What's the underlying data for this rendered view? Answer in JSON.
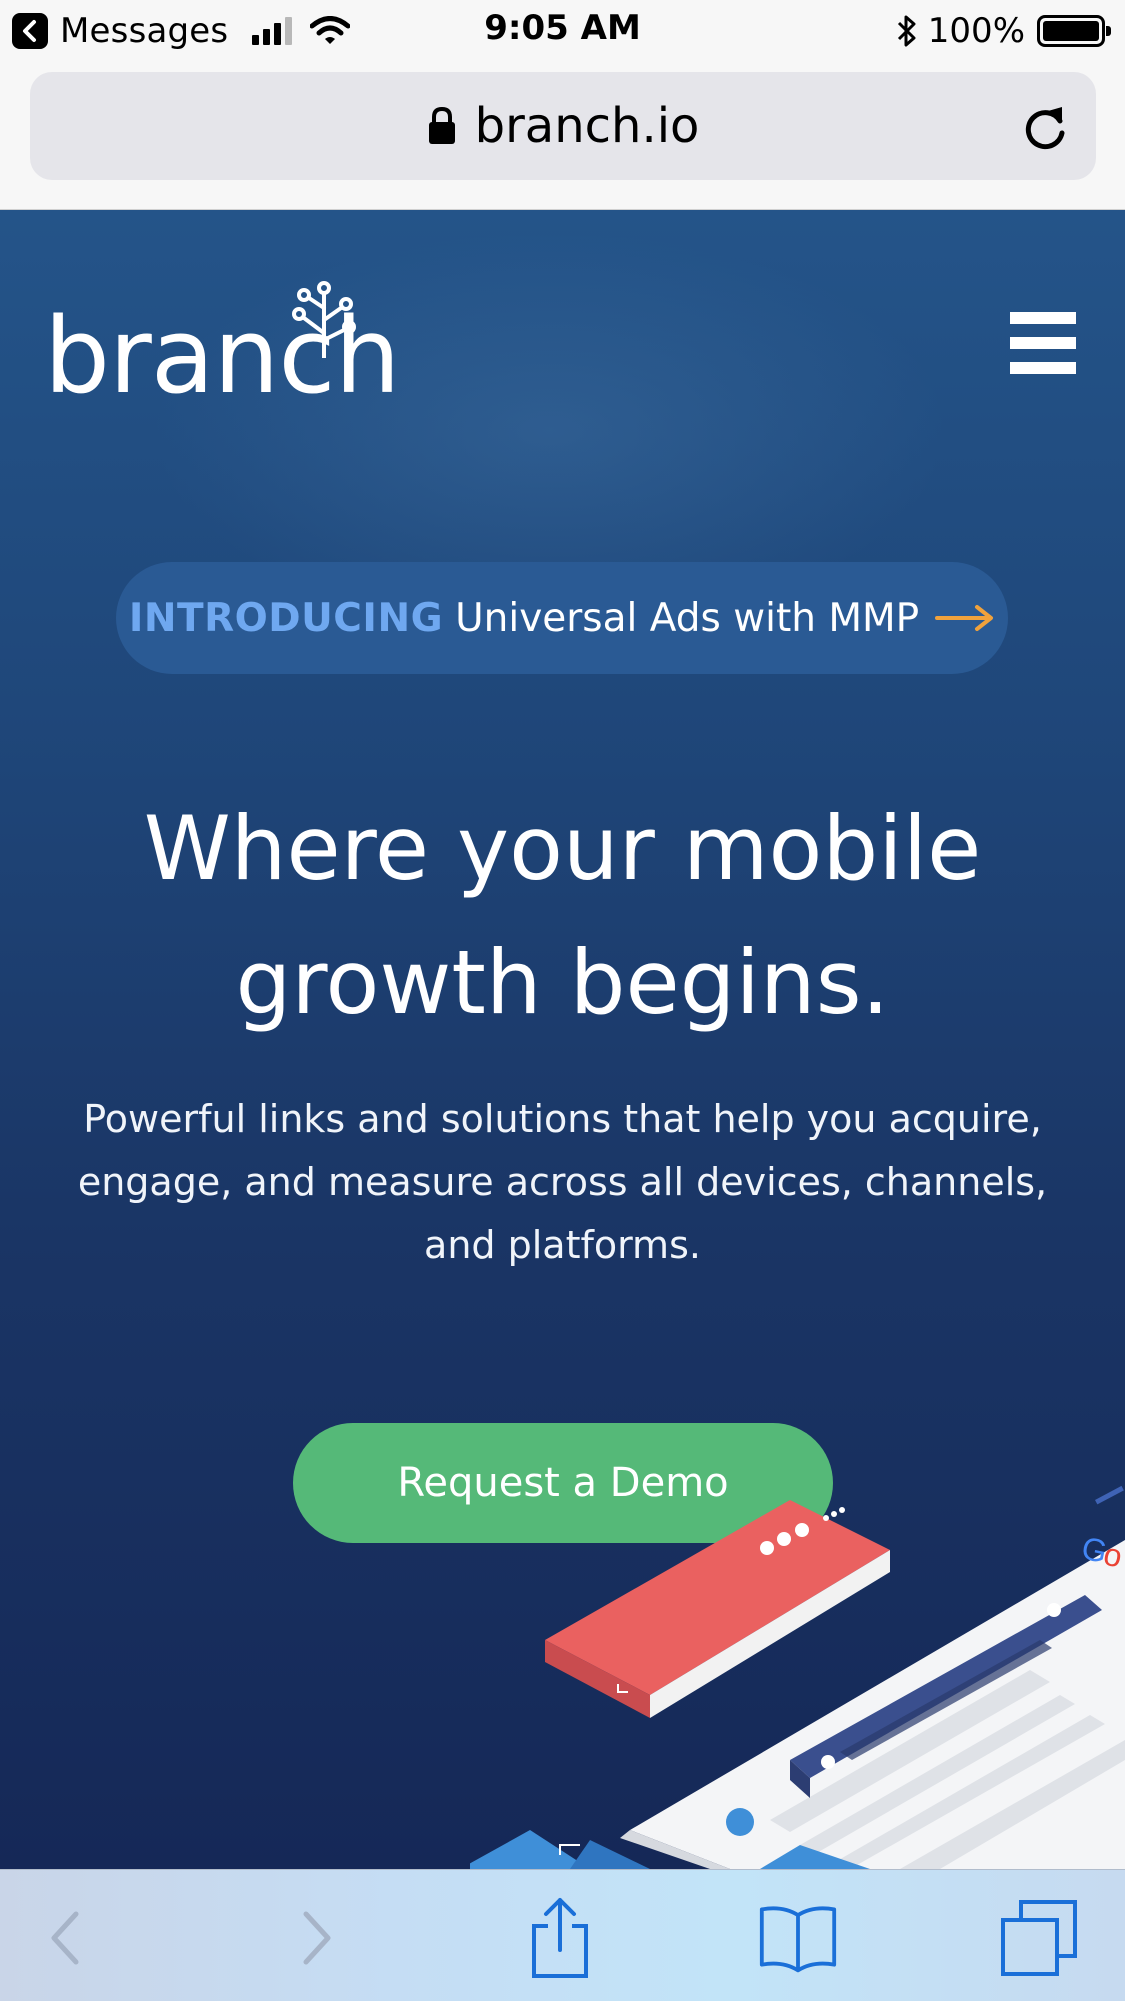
{
  "status_bar": {
    "back_app": "Messages",
    "time": "9:05 AM",
    "battery_percent": "100%",
    "battery_level": 1.0,
    "signal_bars": 3
  },
  "browser": {
    "url": "branch.io"
  },
  "page": {
    "logo_text": "branch",
    "promo": {
      "intro": "INTRODUCING",
      "text": "Universal Ads with MMP"
    },
    "headline_line1": "Where your mobile",
    "headline_line2": "growth begins.",
    "subtext": "Powerful links and solutions that help you acquire, engage, and measure across all devices, channels, and platforms.",
    "cta_label": "Request a Demo"
  },
  "colors": {
    "hero_top": "#245489",
    "hero_bottom": "#152857",
    "promo_intro": "#6fa8f0",
    "promo_arrow": "#f0a23c",
    "cta": "#55b978"
  },
  "toolbar": {
    "icons": [
      "back-icon",
      "forward-icon",
      "share-icon",
      "bookmarks-icon",
      "tabs-icon"
    ]
  }
}
